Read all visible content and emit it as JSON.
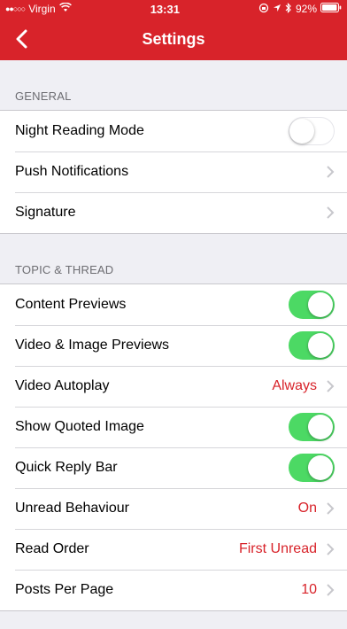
{
  "status": {
    "carrier": "Virgin",
    "time": "13:31",
    "battery": "92%"
  },
  "nav": {
    "title": "Settings"
  },
  "sections": {
    "general": {
      "header": "GENERAL",
      "night_reading_label": "Night Reading Mode",
      "night_reading_on": false,
      "push_notifications_label": "Push Notifications",
      "signature_label": "Signature"
    },
    "topic": {
      "header": "TOPIC & THREAD",
      "content_previews_label": "Content Previews",
      "content_previews_on": true,
      "video_image_previews_label": "Video & Image Previews",
      "video_image_previews_on": true,
      "video_autoplay_label": "Video Autoplay",
      "video_autoplay_value": "Always",
      "show_quoted_image_label": "Show Quoted Image",
      "show_quoted_image_on": true,
      "quick_reply_label": "Quick Reply Bar",
      "quick_reply_on": true,
      "unread_behaviour_label": "Unread Behaviour",
      "unread_behaviour_value": "On",
      "read_order_label": "Read Order",
      "read_order_value": "First Unread",
      "posts_per_page_label": "Posts Per Page",
      "posts_per_page_value": "10"
    }
  },
  "colors": {
    "accent": "#d8232a",
    "toggle_on": "#4cd964",
    "background": "#efeff4"
  },
  "icons": [
    "signal-dots-icon",
    "wifi-icon",
    "orientation-lock-icon",
    "location-icon",
    "bluetooth-icon",
    "battery-icon",
    "back-chevron-icon",
    "chevron-right-icon"
  ]
}
